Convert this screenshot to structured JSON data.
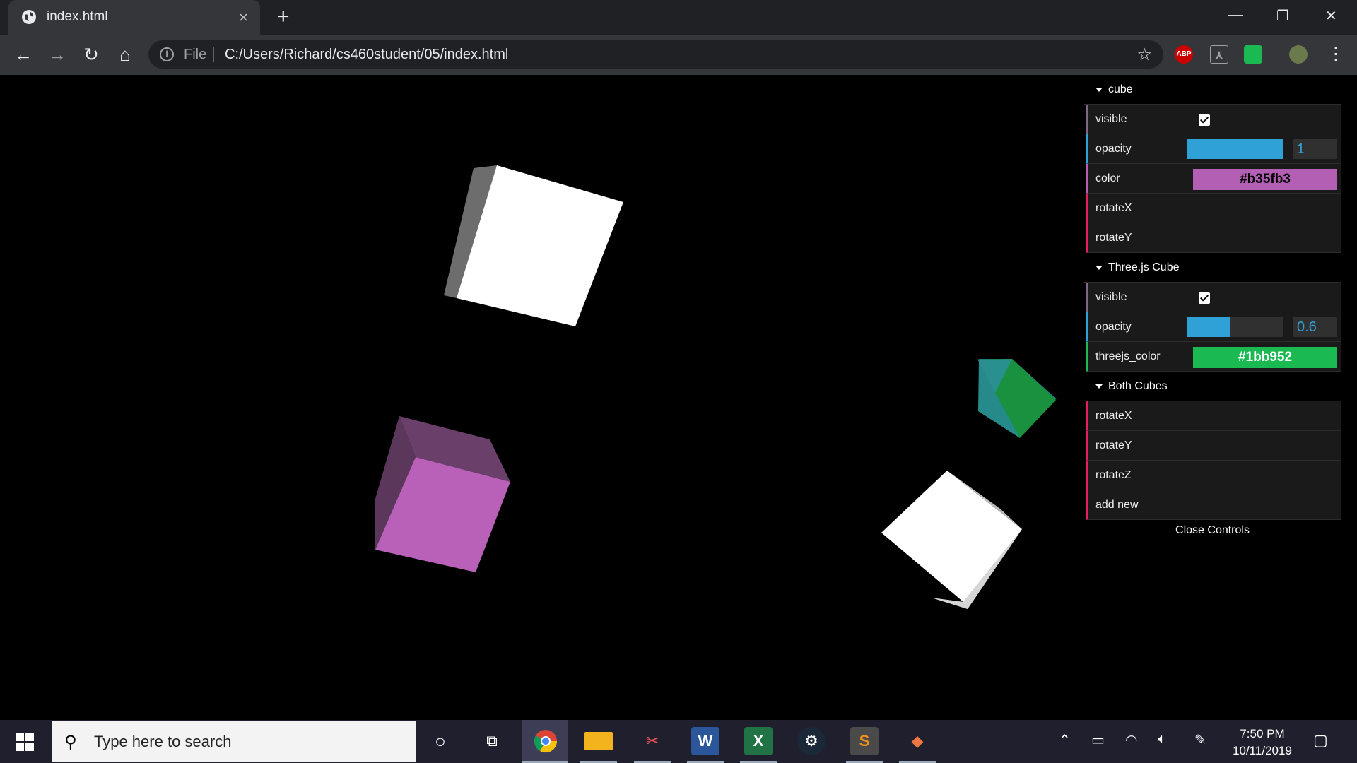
{
  "browser": {
    "tab_title": "index.html",
    "tab_close": "×",
    "new_tab": "+",
    "scheme_label": "File",
    "url": "C:/Users/Richard/cs460student/05/index.html",
    "extensions": [
      "ABP"
    ]
  },
  "gui": {
    "folders": [
      {
        "title": "cube",
        "rows": [
          {
            "label": "visible",
            "type": "bool",
            "value": true
          },
          {
            "label": "opacity",
            "type": "num",
            "value": "1",
            "fraction": 1.0
          },
          {
            "label": "color",
            "type": "color",
            "value": "#b35fb3"
          },
          {
            "label": "rotateX",
            "type": "func"
          },
          {
            "label": "rotateY",
            "type": "func"
          }
        ]
      },
      {
        "title": "Three.js Cube",
        "rows": [
          {
            "label": "visible",
            "type": "bool",
            "value": true
          },
          {
            "label": "opacity",
            "type": "num",
            "value": "0.6",
            "fraction": 0.6
          },
          {
            "label": "threejs_color",
            "type": "color2",
            "value": "#1bb952"
          }
        ]
      },
      {
        "title": "Both Cubes",
        "rows": [
          {
            "label": "rotateX",
            "type": "func"
          },
          {
            "label": "rotateY",
            "type": "func"
          },
          {
            "label": "rotateZ",
            "type": "func"
          },
          {
            "label": "add new",
            "type": "func"
          }
        ]
      }
    ],
    "close_label": "Close Controls"
  },
  "colors": {
    "cube_color": "#b35fb3",
    "threejs_color": "#1bb952",
    "slider": "#2fa1d6"
  },
  "taskbar": {
    "search_placeholder": "Type here to search",
    "time": "7:50 PM",
    "date": "10/11/2019"
  }
}
